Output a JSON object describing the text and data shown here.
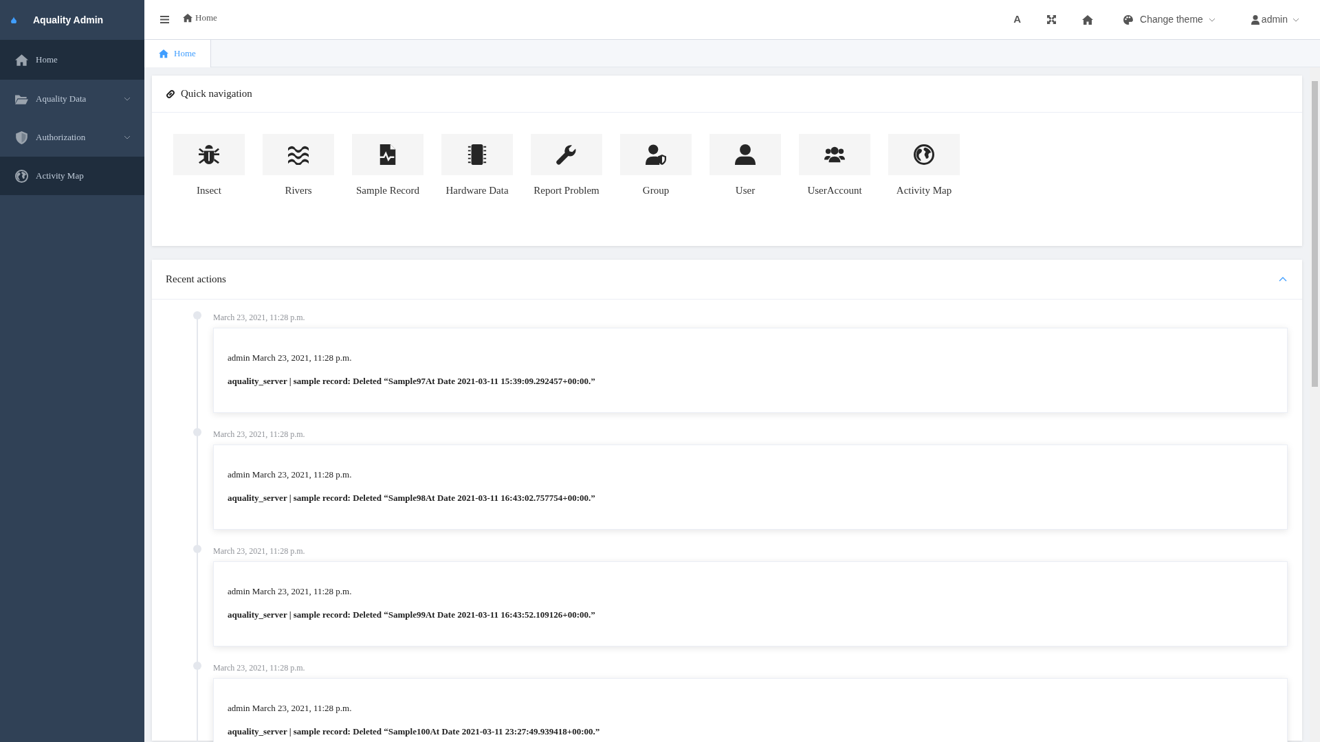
{
  "sidebar": {
    "title": "Aquality Admin",
    "items": [
      {
        "label": "Home",
        "kind": "home",
        "selected": true,
        "expandable": false
      },
      {
        "label": "Aquality Data",
        "kind": "folder",
        "selected": false,
        "expandable": true
      },
      {
        "label": "Authorization",
        "kind": "shield",
        "selected": false,
        "expandable": true
      },
      {
        "label": "Activity Map",
        "kind": "globe",
        "selected": true,
        "expandable": false
      }
    ]
  },
  "header": {
    "breadcrumb": "Home",
    "font_button": "A",
    "theme_menu": "Change theme",
    "user_menu": "admin"
  },
  "tabs": [
    {
      "label": "Home",
      "selected": true
    }
  ],
  "quick_navigation": {
    "title": "Quick navigation",
    "items": [
      {
        "label": "Insect",
        "kind": "bug"
      },
      {
        "label": "Rivers",
        "kind": "water"
      },
      {
        "label": "Sample Record",
        "kind": "file"
      },
      {
        "label": "Hardware Data",
        "kind": "chip"
      },
      {
        "label": "Report Problem",
        "kind": "wrench"
      },
      {
        "label": "Group",
        "kind": "usershield"
      },
      {
        "label": "User",
        "kind": "user"
      },
      {
        "label": "UserAccount",
        "kind": "users"
      },
      {
        "label": "Activity Map",
        "kind": "globe"
      }
    ]
  },
  "recent_actions": {
    "title": "Recent actions",
    "expanded": true,
    "entries": [
      {
        "time": "March 23, 2021, 11:28 p.m.",
        "meta": "admin March 23, 2021, 11:28 p.m.",
        "message": "aquality_server | sample record: Deleted “Sample97At Date 2021-03-11 15:39:09.292457+00:00.”"
      },
      {
        "time": "March 23, 2021, 11:28 p.m.",
        "meta": "admin March 23, 2021, 11:28 p.m.",
        "message": "aquality_server | sample record: Deleted “Sample98At Date 2021-03-11 16:43:02.757754+00:00.”"
      },
      {
        "time": "March 23, 2021, 11:28 p.m.",
        "meta": "admin March 23, 2021, 11:28 p.m.",
        "message": "aquality_server | sample record: Deleted “Sample99At Date 2021-03-11 16:43:52.109126+00:00.”"
      },
      {
        "time": "March 23, 2021, 11:28 p.m.",
        "meta": "admin March 23, 2021, 11:28 p.m.",
        "message": "aquality_server | sample record: Deleted “Sample100At Date 2021-03-11 23:27:49.939418+00:00.”"
      }
    ]
  }
}
